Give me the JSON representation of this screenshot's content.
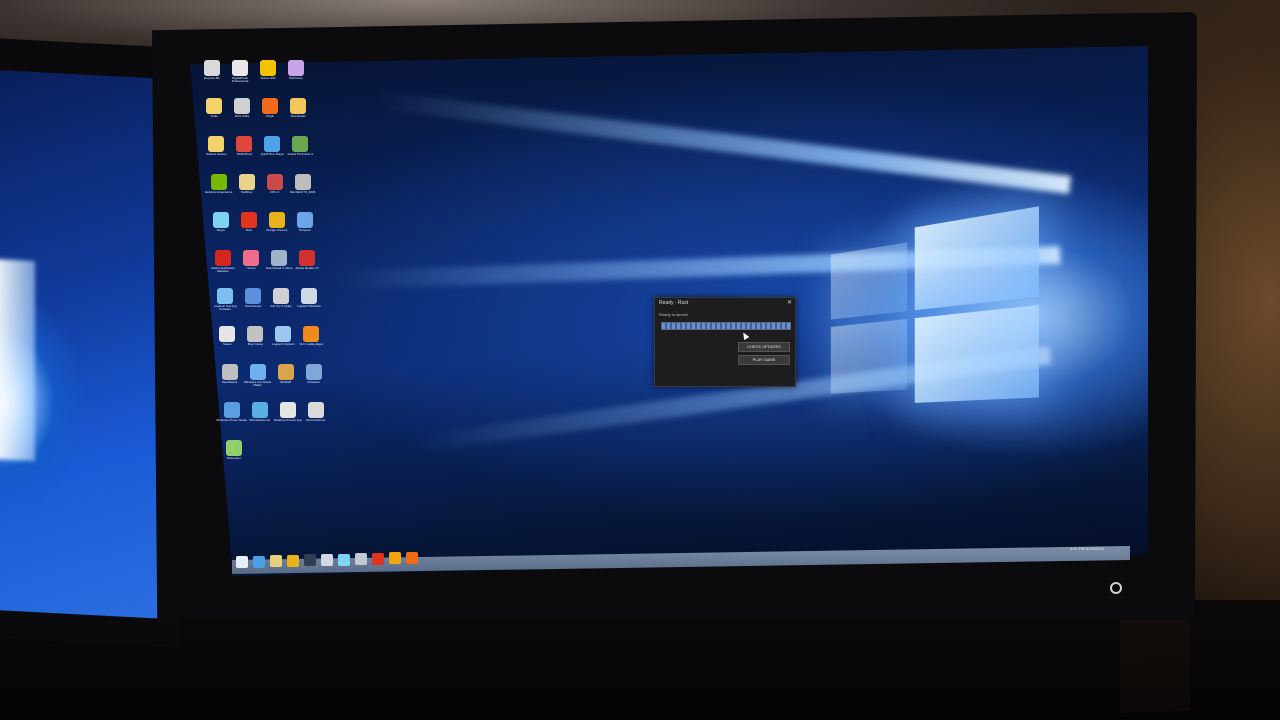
{
  "scene": {
    "left_monitor": "secondary monitor (Windows 10 wallpaper)",
    "main_monitor": "primary monitor"
  },
  "desktop": {
    "icons": [
      {
        "label": "Recycle Bin",
        "icon": "recycle-bin-icon",
        "color": "#d9d9d9"
      },
      {
        "label": "DigitalPhoto Professional",
        "icon": "camera-app-icon",
        "color": "#e8e8e8"
      },
      {
        "label": "Norton 360",
        "icon": "norton-icon",
        "color": "#f2c400"
      },
      {
        "label": "MyPrivacy",
        "icon": "privacy-icon",
        "color": "#c7a4e8"
      },
      {
        "label": "Tools",
        "icon": "folder-icon",
        "color": "#f1d36a"
      },
      {
        "label": "ECS Utility",
        "icon": "utility-icon",
        "color": "#d0d0d0"
      },
      {
        "label": "Origin",
        "icon": "origin-icon",
        "color": "#f26b1a"
      },
      {
        "label": "Downloads",
        "icon": "folder-icon",
        "color": "#f1c75a"
      },
      {
        "label": "Retired Games",
        "icon": "folder-icon",
        "color": "#f1d36a"
      },
      {
        "label": "SIV64Tools",
        "icon": "tool-icon",
        "color": "#e0463a"
      },
      {
        "label": "QuickTime Player",
        "icon": "quicktime-icon",
        "color": "#4fa3e8"
      },
      {
        "label": "Grand Theft Auto V",
        "icon": "gta-icon",
        "color": "#6aa84f"
      },
      {
        "label": "GeForce Experience",
        "icon": "nvidia-icon",
        "color": "#76b900"
      },
      {
        "label": "SwiftKey",
        "icon": "keyboard-icon",
        "color": "#e8d38a"
      },
      {
        "label": "CPU-Z",
        "icon": "cpuz-icon",
        "color": "#c94a4a"
      },
      {
        "label": "MemSplit TX_3036",
        "icon": "memory-icon",
        "color": "#bdbdbd"
      },
      {
        "label": "Skype",
        "icon": "skype-icon",
        "color": "#7fd3f2"
      },
      {
        "label": "Rust",
        "icon": "rust-icon",
        "color": "#e0341e"
      },
      {
        "label": "Google Chrome",
        "icon": "chrome-icon",
        "color": "#e8b31a"
      },
      {
        "label": "Notepad",
        "icon": "notepad-icon",
        "color": "#6ba6e8"
      },
      {
        "label": "Adobe Application Manager",
        "icon": "adobe-icon",
        "color": "#d3261e"
      },
      {
        "label": "iTunes",
        "icon": "itunes-icon",
        "color": "#f06a8a"
      },
      {
        "label": "TeamSpeak 3 Client",
        "icon": "teamspeak-icon",
        "color": "#9fb4c8"
      },
      {
        "label": "Adobe Reader XI",
        "icon": "acrobat-icon",
        "color": "#d32f2f"
      },
      {
        "label": "Logitech Gaming Software",
        "icon": "logitech-icon",
        "color": "#7bc0f0"
      },
      {
        "label": "TeamViewer",
        "icon": "teamviewer-icon",
        "color": "#5d8fdc"
      },
      {
        "label": "Far Cry 4 Uplay",
        "icon": "game-icon",
        "color": "#d0d0d0"
      },
      {
        "label": "Logitech Webcam",
        "icon": "webcam-icon",
        "color": "#cfd9e6"
      },
      {
        "label": "Steam",
        "icon": "steam-icon",
        "color": "#e6e6e6"
      },
      {
        "label": "Boot Camp",
        "icon": "bootcamp-icon",
        "color": "#c2c2c2"
      },
      {
        "label": "Logitech Options",
        "icon": "logitech-icon",
        "color": "#9fc6ef"
      },
      {
        "label": "VLC media player",
        "icon": "vlc-icon",
        "color": "#f08a1a"
      },
      {
        "label": "SteelSeries",
        "icon": "steelseries-icon",
        "color": "#bfbfbf"
      },
      {
        "label": "Windows Live Movie Maker",
        "icon": "movie-icon",
        "color": "#6fb0f0"
      },
      {
        "label": "WinRAR",
        "icon": "winrar-icon",
        "color": "#d8a54a"
      },
      {
        "label": "CCleaner",
        "icon": "ccleaner-icon",
        "color": "#7fa8d8"
      },
      {
        "label": "Windows Photo Viewer",
        "icon": "photos-icon",
        "color": "#5a9de0"
      },
      {
        "label": "MSI Afterburner",
        "icon": "afterburner-icon",
        "color": "#58b0e6"
      },
      {
        "label": "Desktop Product Key",
        "icon": "key-icon",
        "color": "#e4e4e4"
      },
      {
        "label": "DriverScanner",
        "icon": "scanner-icon",
        "color": "#d9d9d9"
      },
      {
        "label": "Rainmeter",
        "icon": "rainmeter-icon",
        "color": "#8fd06a"
      }
    ]
  },
  "dialog": {
    "title": "Ready - Rust",
    "status": "Ready to launch",
    "progress_percent": 100,
    "btn_check_updates": "CHECK UPDATES",
    "btn_play": "PLAY GAME",
    "close_glyph": "✕"
  },
  "taskbar": {
    "start_label": "Start",
    "pinned": [
      {
        "name": "start-button",
        "color": "#e8eef8"
      },
      {
        "name": "ie-icon",
        "color": "#4aa0e8"
      },
      {
        "name": "explorer-icon",
        "color": "#e8d07a"
      },
      {
        "name": "chrome-icon",
        "color": "#e8b31a"
      },
      {
        "name": "steam-icon",
        "color": "#2f3e55"
      },
      {
        "name": "media-icon",
        "color": "#d0d8e4"
      },
      {
        "name": "skype-icon",
        "color": "#7fd3f2"
      },
      {
        "name": "settings-icon",
        "color": "#c0c8d4"
      },
      {
        "name": "rust-icon",
        "color": "#e0341e"
      },
      {
        "name": "plex-icon",
        "color": "#f2a60d"
      },
      {
        "name": "origin-icon",
        "color": "#f26b1a"
      }
    ],
    "tray_time": "4:57 PM",
    "tray_date": "8/19/2015"
  }
}
